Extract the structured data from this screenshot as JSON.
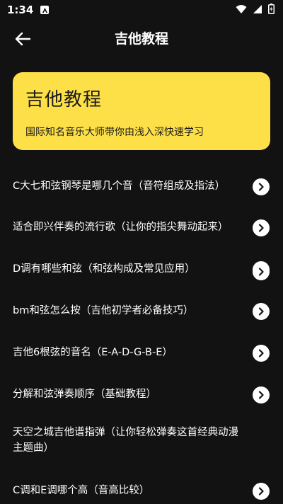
{
  "status_bar": {
    "time": "1:34"
  },
  "app_bar": {
    "title": "吉他教程"
  },
  "banner": {
    "title": "吉他教程",
    "subtitle": "国际知名音乐大师带你由浅入深快速学习",
    "color": "#fde047"
  },
  "items": [
    {
      "label": "C大七和弦钢琴是哪几个音（音符组成及指法）"
    },
    {
      "label": "适合即兴伴奏的流行歌（让你的指尖舞动起来）"
    },
    {
      "label": "D调有哪些和弦（和弦构成及常见应用）"
    },
    {
      "label": "bm和弦怎么按（吉他初学者必备技巧）"
    },
    {
      "label": "吉他6根弦的音名（E-A-D-G-B-E）"
    },
    {
      "label": "分解和弦弹奏顺序（基础教程）"
    },
    {
      "label": "天空之城吉他谱指弹（让你轻松弹奏这首经典动漫主题曲）"
    },
    {
      "label": "C调和E调哪个高（音高比较）"
    }
  ],
  "colors": {
    "background": "#121212",
    "accent": "#fde047",
    "text": "#ffffff"
  }
}
